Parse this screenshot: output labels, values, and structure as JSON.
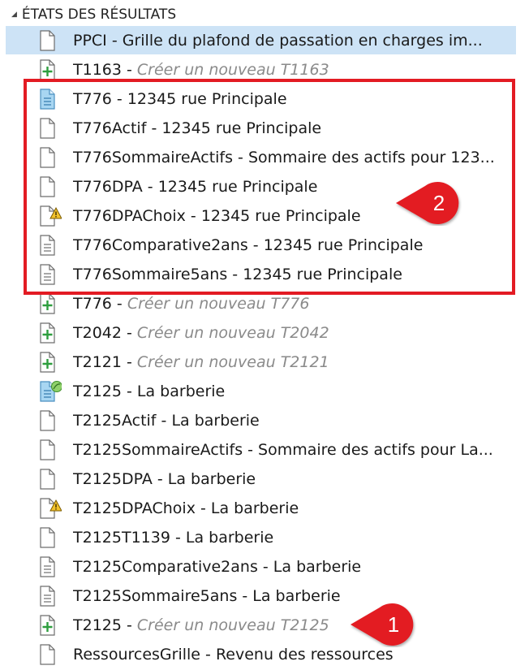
{
  "header": {
    "title": "ÉTATS DES RÉSULTATS"
  },
  "items": [
    {
      "code": "PPCI",
      "sep": " - ",
      "desc": "Grille du plafond de passation en charges im...",
      "italic": false,
      "icon": "doc-icon",
      "selected": true
    },
    {
      "code": "T1163",
      "sep": " - ",
      "desc": "Créer un nouveau T1163",
      "italic": true,
      "icon": "add-form-icon"
    },
    {
      "code": "T776",
      "sep": " - ",
      "desc": "12345 rue Principale",
      "italic": false,
      "icon": "form-blue-icon"
    },
    {
      "code": "T776Actif",
      "sep": " - ",
      "desc": "12345 rue Principale",
      "italic": false,
      "icon": "doc-icon"
    },
    {
      "code": "T776SommaireActifs",
      "sep": " - ",
      "desc": "Sommaire des actifs pour 123...",
      "italic": false,
      "icon": "doc-icon"
    },
    {
      "code": "T776DPA",
      "sep": " - ",
      "desc": "12345 rue Principale",
      "italic": false,
      "icon": "doc-icon"
    },
    {
      "code": "T776DPAChoix",
      "sep": " - ",
      "desc": "12345 rue Principale",
      "italic": false,
      "icon": "doc-warning-icon"
    },
    {
      "code": "T776Comparative2ans",
      "sep": " - ",
      "desc": "12345 rue Principale",
      "italic": false,
      "icon": "doc-lines-icon"
    },
    {
      "code": "T776Sommaire5ans",
      "sep": " - ",
      "desc": "12345 rue Principale",
      "italic": false,
      "icon": "doc-lines-icon"
    },
    {
      "code": "T776",
      "sep": " - ",
      "desc": "Créer un nouveau T776",
      "italic": true,
      "icon": "add-form-icon"
    },
    {
      "code": "T2042",
      "sep": " - ",
      "desc": "Créer un nouveau T2042",
      "italic": true,
      "icon": "add-form-icon"
    },
    {
      "code": "T2121",
      "sep": " - ",
      "desc": "Créer un nouveau T2121",
      "italic": true,
      "icon": "add-form-icon"
    },
    {
      "code": "T2125",
      "sep": " - ",
      "desc": "La barberie",
      "italic": false,
      "icon": "form-blue-leaf-icon"
    },
    {
      "code": "T2125Actif",
      "sep": " - ",
      "desc": "La barberie",
      "italic": false,
      "icon": "doc-icon"
    },
    {
      "code": "T2125SommaireActifs",
      "sep": " - ",
      "desc": "Sommaire des actifs pour La...",
      "italic": false,
      "icon": "doc-icon"
    },
    {
      "code": "T2125DPA",
      "sep": " - ",
      "desc": "La barberie",
      "italic": false,
      "icon": "doc-icon"
    },
    {
      "code": "T2125DPAChoix",
      "sep": " - ",
      "desc": "La barberie",
      "italic": false,
      "icon": "doc-warning-icon"
    },
    {
      "code": "T2125T1139",
      "sep": " - ",
      "desc": "La barberie",
      "italic": false,
      "icon": "doc-icon"
    },
    {
      "code": "T2125Comparative2ans",
      "sep": " - ",
      "desc": "La barberie",
      "italic": false,
      "icon": "doc-lines-icon"
    },
    {
      "code": "T2125Sommaire5ans",
      "sep": " - ",
      "desc": "La barberie",
      "italic": false,
      "icon": "doc-lines-icon"
    },
    {
      "code": "T2125",
      "sep": " - ",
      "desc": "Créer un nouveau T2125",
      "italic": true,
      "icon": "add-form-icon"
    },
    {
      "code": "RessourcesGrille",
      "sep": " - ",
      "desc": "Revenu des ressources",
      "italic": false,
      "icon": "doc-icon"
    }
  ],
  "callouts": [
    {
      "label": "2"
    },
    {
      "label": "1"
    }
  ],
  "colors": {
    "selection": "#cde3f6",
    "callout": "#e31b23",
    "add_green": "#2e9e3e",
    "form_blue": "#7fc0e8",
    "warning": "#f2c22c"
  }
}
